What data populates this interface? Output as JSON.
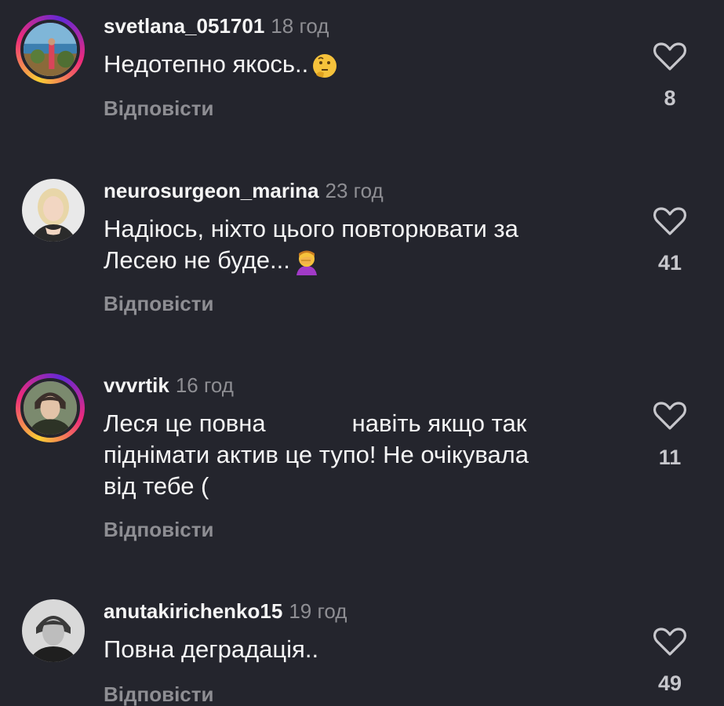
{
  "comments": [
    {
      "username": "svetlana_051701",
      "time": "18 год",
      "lines": [
        "Недотепно якось.."
      ],
      "emoji": "thinking-face",
      "reply": "Відповісти",
      "likes": "8",
      "avatar_icon": "avatar-photo-landscape"
    },
    {
      "username": "neurosurgeon_marina",
      "time": "23 год",
      "lines": [
        "Надіюсь, ніхто цього повторювати за",
        "Лесею не буде..."
      ],
      "emoji": "facepalm",
      "reply": "Відповісти",
      "likes": "41",
      "avatar_icon": "avatar-photo-woman-blonde"
    },
    {
      "username": "vvvrtik",
      "time": "16 год",
      "lines": [
        "Леся це повна",
        "навіть якщо так",
        "піднімати актив це тупо! Не очікувала",
        "від тебе ("
      ],
      "reply": "Відповісти",
      "likes": "11",
      "avatar_icon": "avatar-photo-woman-short-hair"
    },
    {
      "username": "anutakirichenko15",
      "time": "19 год",
      "lines": [
        "Повна деградація.."
      ],
      "reply": "Відповісти",
      "likes": "49",
      "avatar_icon": "avatar-photo-woman-grayscale"
    }
  ],
  "colors": {
    "background": "#24252d",
    "text": "#f5f5f5",
    "muted": "#8e8e93",
    "story_ring": [
      "#f9ce34",
      "#ee2a7b",
      "#6228d7"
    ]
  }
}
